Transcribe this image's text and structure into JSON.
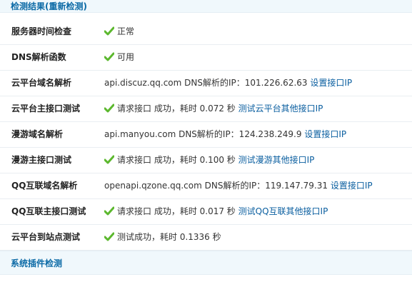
{
  "header": {
    "title": "检测结果",
    "recheck_open": "(",
    "recheck_link": "重新检测",
    "recheck_close": ")"
  },
  "rows": [
    {
      "label": "服务器时间检查",
      "status": "正常"
    },
    {
      "label": "DNS解析函数",
      "status": "可用"
    },
    {
      "label": "云平台域名解析",
      "text": "api.discuz.qq.com DNS解析的IP：101.226.62.63",
      "link": "设置接口IP"
    },
    {
      "label": "云平台主接口测试",
      "text": "请求接口 成功，耗时 0.072 秒",
      "link": "测试云平台其他接口IP"
    },
    {
      "label": "漫游域名解析",
      "text": "api.manyou.com DNS解析的IP：124.238.249.9",
      "link": "设置接口IP"
    },
    {
      "label": "漫游主接口测试",
      "text": "请求接口 成功，耗时 0.100 秒",
      "link": "测试漫游其他接口IP"
    },
    {
      "label": "QQ互联域名解析",
      "text": "openapi.qzone.qq.com DNS解析的IP：119.147.79.31",
      "link": "设置接口IP"
    },
    {
      "label": "QQ互联主接口测试",
      "text": "请求接口 成功，耗时 0.017 秒",
      "link": "测试QQ互联其他接口IP"
    },
    {
      "label": "云平台到站点测试",
      "text": "测试成功，耗时 0.1336 秒"
    }
  ],
  "section2": {
    "title": "系统插件检测"
  },
  "icons": {
    "check": "check-icon"
  },
  "colors": {
    "check_green": "#5cb82e",
    "link_blue": "#0b5fa0",
    "header_bg": "#f0f8fc",
    "header_text": "#0b6aa6"
  }
}
